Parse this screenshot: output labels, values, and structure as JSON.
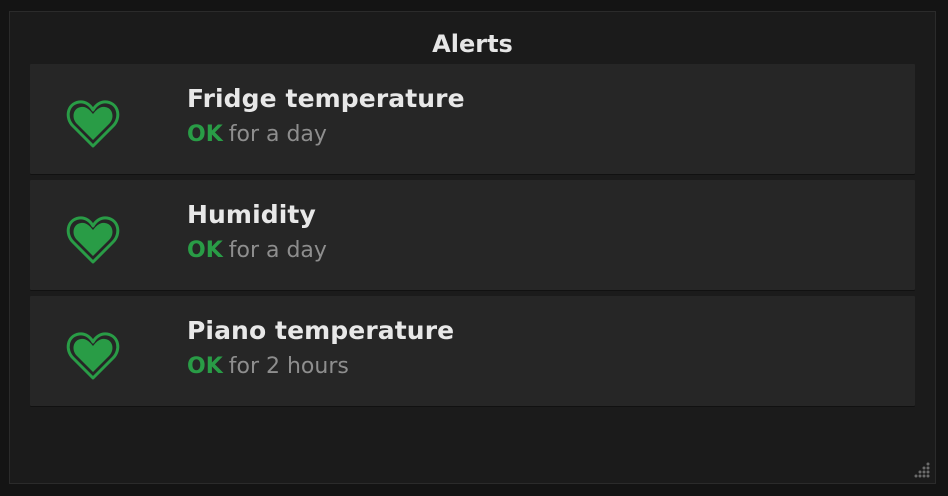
{
  "panel": {
    "title": "Alerts"
  },
  "colors": {
    "ok": "#299c46",
    "background": "#141414",
    "panel": "#1b1b1b",
    "card": "#262626"
  },
  "alerts": [
    {
      "name": "Fridge temperature",
      "state": "OK",
      "duration": "for a day",
      "icon": "heart-icon"
    },
    {
      "name": "Humidity",
      "state": "OK",
      "duration": "for a day",
      "icon": "heart-icon"
    },
    {
      "name": "Piano temperature",
      "state": "OK",
      "duration": "for 2 hours",
      "icon": "heart-icon"
    }
  ],
  "panel_controls": {
    "resize_icon": "resize-handle-icon"
  }
}
